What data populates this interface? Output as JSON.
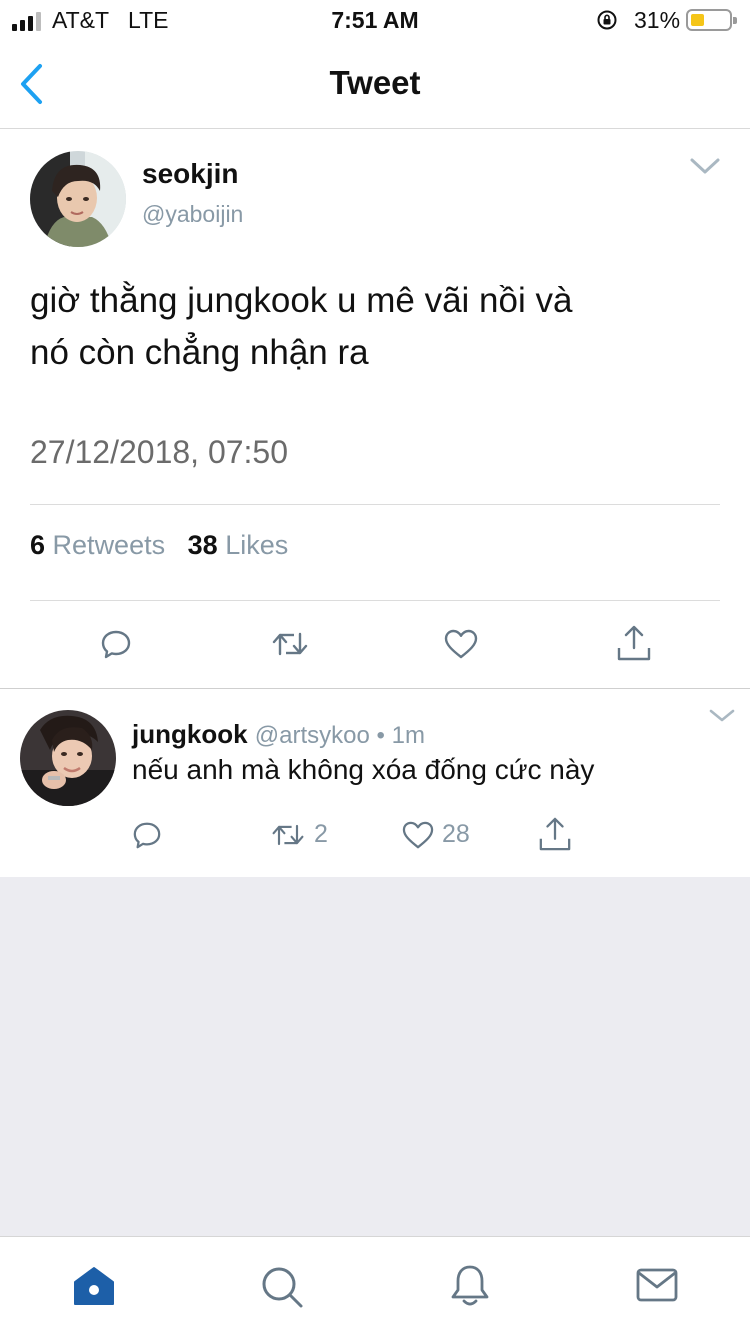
{
  "status_bar": {
    "carrier": "AT&T",
    "network": "LTE",
    "time": "7:51 AM",
    "battery_percent": "31%",
    "battery_level": 0.31
  },
  "nav": {
    "title": "Tweet"
  },
  "tweet": {
    "display_name": "seokjin",
    "handle": "@yaboijin",
    "text_line1": "giờ thằng jungkook u mê vãi nồi và",
    "text_line2": "nó còn chẳng nhận ra",
    "timestamp": "27/12/2018, 07:50",
    "retweet_count": "6",
    "retweet_label": "Retweets",
    "like_count": "38",
    "like_label": "Likes"
  },
  "reply": {
    "display_name": "jungkook",
    "handle_time": "@artsykoo • 1m",
    "text": "nếu anh mà không xóa đống cức này",
    "retweet_count": "2",
    "like_count": "28"
  },
  "icons": {
    "back": "chevron-left-icon",
    "reply": "comment-icon",
    "retweet": "retweet-icon",
    "like": "heart-icon",
    "share": "share-icon",
    "home": "home-icon",
    "search": "search-icon",
    "notifications": "bell-icon",
    "messages": "mail-icon"
  },
  "colors": {
    "accent": "#1da1f2",
    "secondary_text": "#8899a6",
    "active_tab": "#1d5fa8"
  }
}
